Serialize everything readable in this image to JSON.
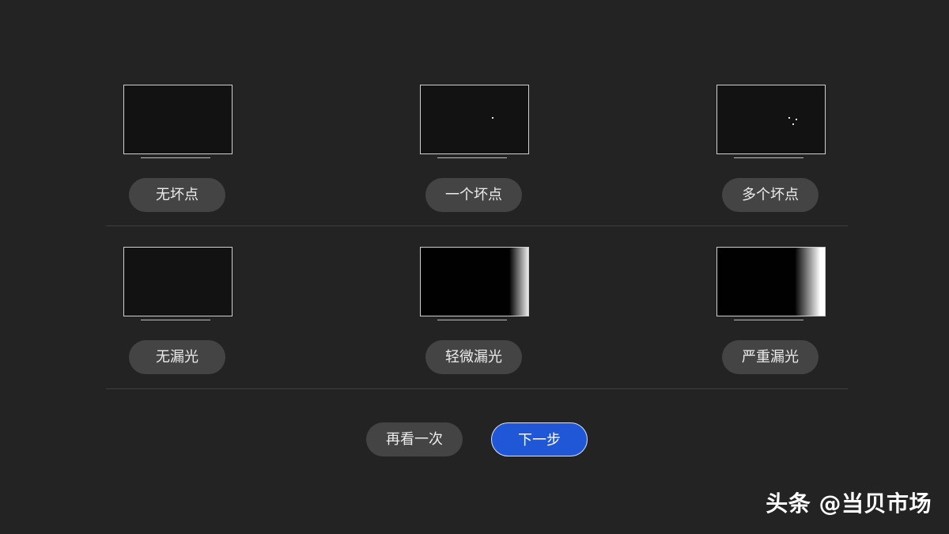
{
  "dead_pixel_options": {
    "none_label": "无坏点",
    "one_label": "一个坏点",
    "many_label": "多个坏点"
  },
  "light_leak_options": {
    "none_label": "无漏光",
    "slight_label": "轻微漏光",
    "severe_label": "严重漏光"
  },
  "actions": {
    "retry_label": "再看一次",
    "next_label": "下一步"
  },
  "watermark": {
    "text": "头条 @当贝市场"
  },
  "colors": {
    "background": "#232323",
    "pill": "#444444",
    "primary": "#1f57d6"
  }
}
